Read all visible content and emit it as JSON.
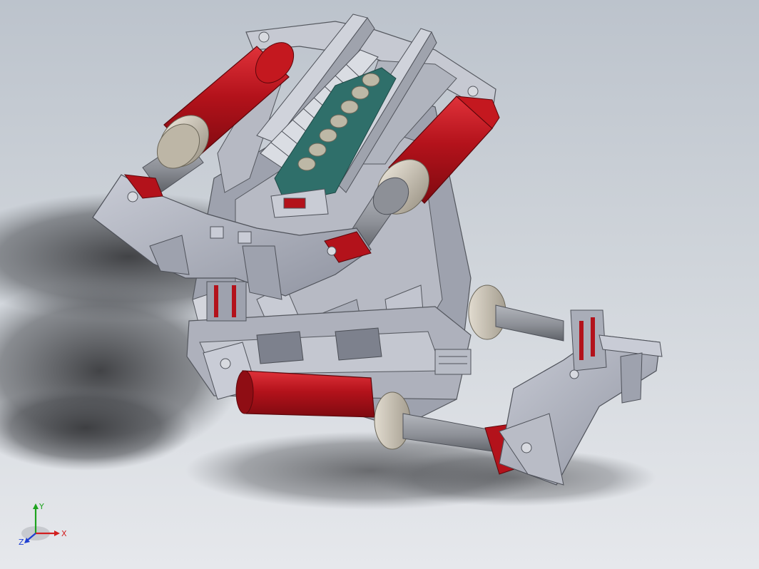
{
  "viewport": {
    "background_top": "#bcc3cc",
    "background_bottom": "#e6e8ec"
  },
  "model": {
    "colors": {
      "frame_gray": "#a7abb7",
      "frame_light": "#c9ccd6",
      "frame_dark": "#6f7380",
      "cylinder_red": "#b3121b",
      "cylinder_red_dark": "#7e0a10",
      "cylinder_cap": "#c9c2b4",
      "rod_gray": "#8d9097",
      "rail_gray": "#b8bcc6",
      "teal_carriage": "#2f6f6a",
      "roller_beige": "#bdb8a6",
      "shadow": "#3a3b3e"
    }
  },
  "triad": {
    "x_label": "X",
    "y_label": "Y",
    "z_label": "Z",
    "colors": {
      "x": "#d21f1f",
      "y": "#1ea31e",
      "z": "#1f3fd2"
    }
  }
}
